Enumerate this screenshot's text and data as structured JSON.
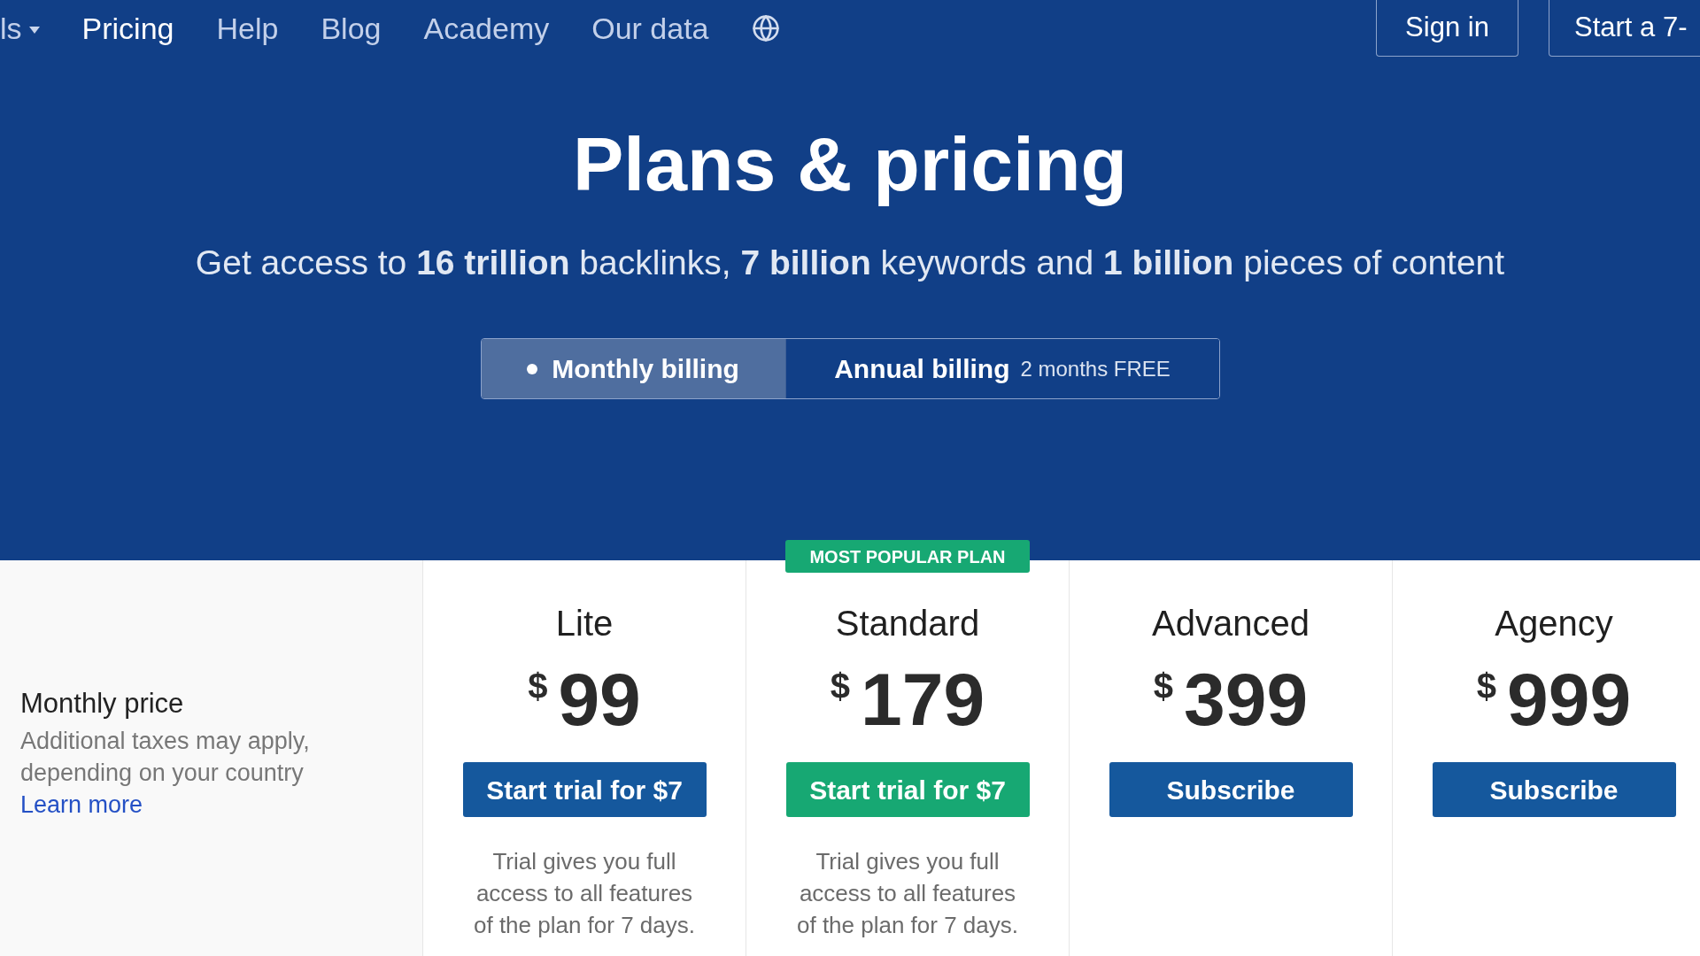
{
  "nav": {
    "items": [
      {
        "label": "ls",
        "kind": "dropdown",
        "selected": false
      },
      {
        "label": "Pricing",
        "kind": "link",
        "selected": true
      },
      {
        "label": "Help",
        "kind": "link",
        "selected": false
      },
      {
        "label": "Blog",
        "kind": "link",
        "selected": false
      },
      {
        "label": "Academy",
        "kind": "link",
        "selected": false
      },
      {
        "label": "Our data",
        "kind": "link",
        "selected": false
      }
    ],
    "actions": [
      {
        "label": "Sign in"
      },
      {
        "label": "Start a 7-"
      }
    ]
  },
  "hero": {
    "title": "Plans & pricing",
    "subtitle": "Get access to **16 trillion** backlinks, **7 billion** keywords and **1 billion** pieces of content",
    "billing": [
      {
        "label": "Monthly billing",
        "selected": true
      },
      {
        "label": "Annual billing",
        "note": "2 months FREE",
        "selected": false
      }
    ]
  },
  "pricing": {
    "row_label": {
      "title": "Monthly price",
      "note": "Additional taxes may apply, depending on your country",
      "link": "Learn more"
    },
    "plans": [
      {
        "name": "Lite",
        "currency": "$",
        "amount": "99",
        "button": "Start trial for $7",
        "featured": false,
        "note": "Trial gives you full access to all features of the plan for 7 days."
      },
      {
        "name": "Standard",
        "badge": "MOST POPULAR PLAN",
        "currency": "$",
        "amount": "179",
        "button": "Start trial for $7",
        "featured": true,
        "note": "Trial gives you full access to all features of the plan for 7 days."
      },
      {
        "name": "Advanced",
        "currency": "$",
        "amount": "399",
        "button": "Subscribe",
        "featured": false
      },
      {
        "name": "Agency",
        "currency": "$",
        "amount": "999",
        "button": "Subscribe",
        "featured": false
      }
    ]
  }
}
